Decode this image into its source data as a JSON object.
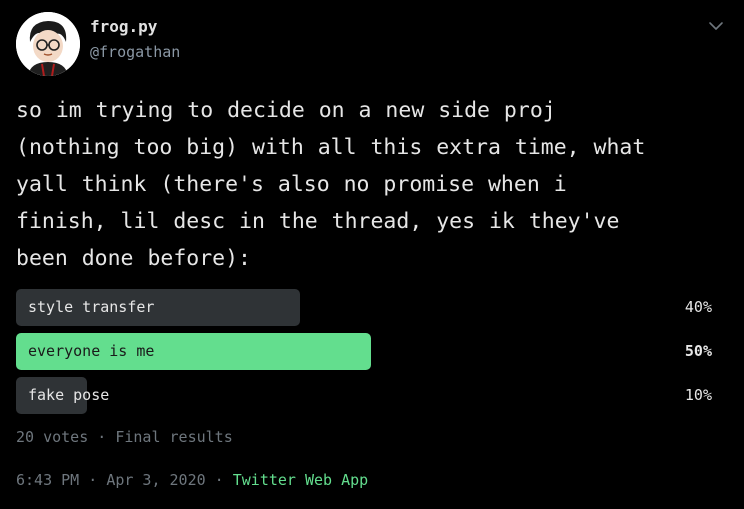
{
  "user": {
    "display_name": "frog.py",
    "handle": "@frogathan"
  },
  "tweet": {
    "text": "so im trying to decide on a new side proj\n(nothing too big) with all this extra time, what\nyall think (there's also no promise when i\nfinish, lil desc in the thread, yes ik they've\nbeen done before):"
  },
  "poll": {
    "options": [
      {
        "label": "style transfer",
        "percent_label": "40%",
        "percent": 40
      },
      {
        "label": "everyone is me",
        "percent_label": "50%",
        "percent": 50
      },
      {
        "label": "fake pose",
        "percent_label": "10%",
        "percent": 10
      }
    ],
    "votes": "20 votes",
    "separator": " · ",
    "status": "Final results"
  },
  "meta": {
    "time": "6:43 PM",
    "date": "Apr 3, 2020",
    "separator": " · ",
    "source": "Twitter Web App"
  },
  "colors": {
    "background": "#000000",
    "accent": "#63de8e",
    "bar": "#2f3336",
    "muted": "#6e767d"
  },
  "icons": {
    "menu": "chevron-down-icon",
    "avatar": "cartoon-avatar"
  }
}
